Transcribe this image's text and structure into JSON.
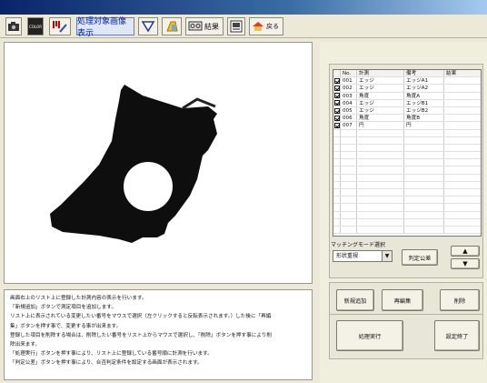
{
  "toolbar": {
    "items": [
      {
        "icon": "camera-icon"
      },
      {
        "icon": "color-icon",
        "label": "COLOR"
      },
      {
        "icon": "measure-icon"
      },
      {
        "label": "処理対象画像表示"
      },
      {
        "icon": "shape-icon"
      },
      {
        "icon": "folder-icon"
      },
      {
        "icon": "monitor-icon",
        "label": "結果"
      },
      {
        "icon": "image-icon"
      },
      {
        "icon": "home-icon",
        "label": "戻る"
      }
    ]
  },
  "table": {
    "headers": {
      "no": "No.",
      "measure": "計測",
      "name": "備考",
      "result": "結果"
    },
    "rows": [
      {
        "no": "001",
        "measure": "エッジ",
        "name": "エッジA1",
        "result": ""
      },
      {
        "no": "002",
        "measure": "エッジ",
        "name": "エッジA2",
        "result": ""
      },
      {
        "no": "003",
        "measure": "角度",
        "name": "角度A",
        "result": ""
      },
      {
        "no": "004",
        "measure": "エッジ",
        "name": "エッジB1",
        "result": ""
      },
      {
        "no": "005",
        "measure": "エッジ",
        "name": "エッジB2",
        "result": ""
      },
      {
        "no": "006",
        "measure": "角度",
        "name": "角度B",
        "result": ""
      },
      {
        "no": "007",
        "measure": "円",
        "name": "円",
        "result": ""
      }
    ]
  },
  "matching": {
    "label": "マッチングモード選択",
    "selected": "形状重視",
    "judge_button": "判定公差"
  },
  "buttons": {
    "add": "新規追加",
    "edit": "再編集",
    "delete": "削除",
    "execute": "処理実行",
    "finish": "設定終了"
  },
  "description": [
    "画面右上のリスト上に登録した計測内容の表示を行います。",
    "「新規追加」ボタンで測定項目を追加します。",
    "リスト上に表示されている変更したい番号をマウスで選択（左クリックすると反転表示されます。）した後に「再編",
    "集」ボタンを押す事で、変更する事が出来ます。",
    "登録した項目を削除する場合は、削除したい番号をリスト上からマウスで選択し、「削除」ボタンを押す事により削",
    "除出来ます。",
    "「処理実行」ボタンを押す事により、リスト上に登録している番号順に計測を行います。",
    "「判定公差」ボタンを押す事により、合否判定条件を設定する画面が表示されます。"
  ],
  "colors": {
    "accent": "#0a246a",
    "background": "#ece9d8"
  }
}
